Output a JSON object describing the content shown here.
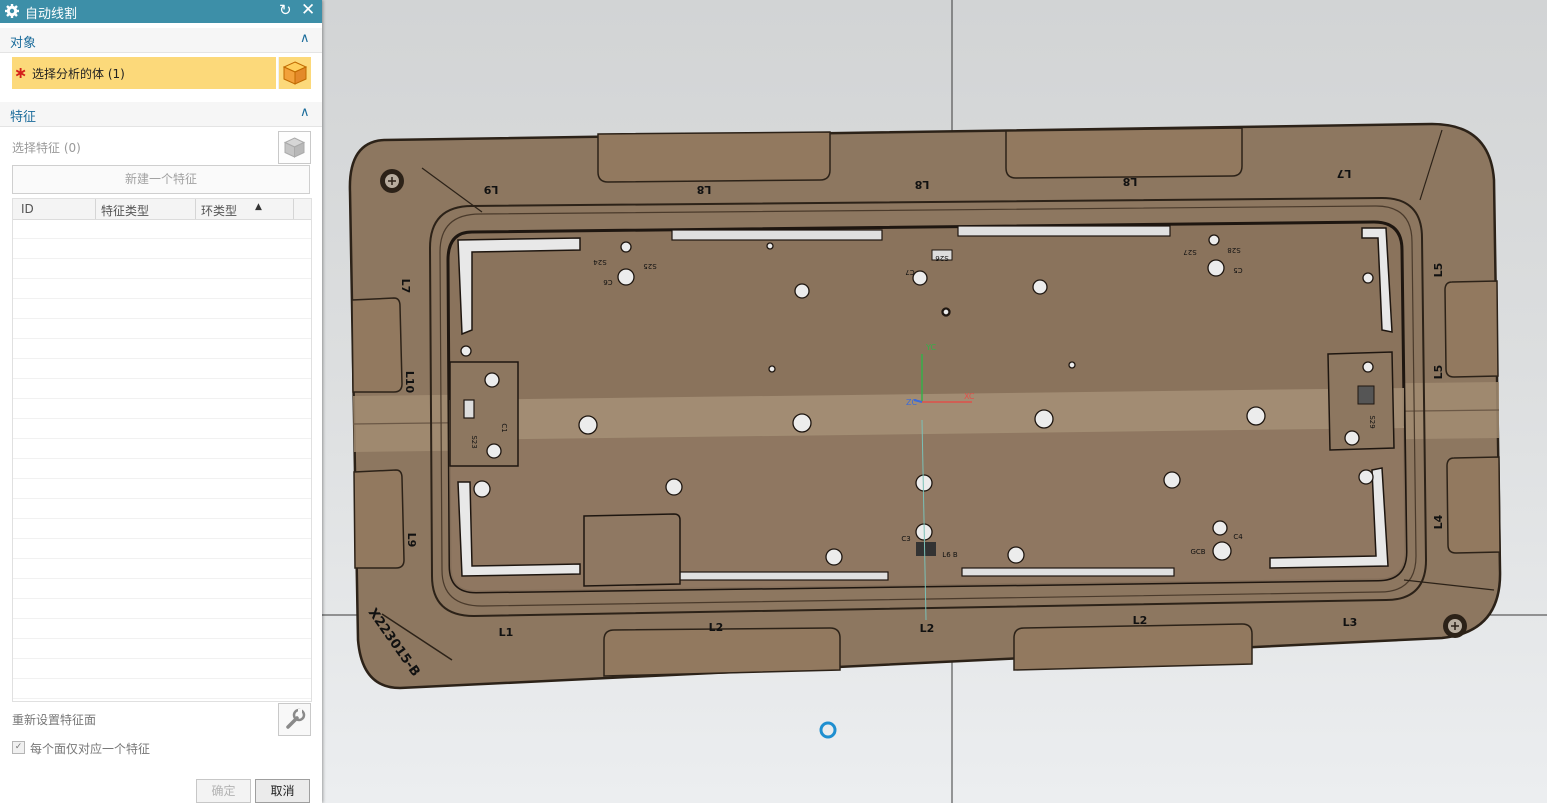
{
  "dialog": {
    "title": "自动线割",
    "groups": {
      "object": {
        "header": "对象",
        "select_body_label": "选择分析的体 (1)"
      },
      "feature": {
        "header": "特征",
        "select_feature_label": "选择特征 (0)",
        "new_feature_button": "新建一个特征",
        "table_columns": [
          "ID",
          "特征类型",
          "环类型"
        ],
        "reset_faces_label": "重新设置特征面",
        "one_feature_per_face_label": "每个面仅对应一个特征",
        "one_feature_per_face_checked": true
      }
    },
    "ok_button": "确定",
    "cancel_button": "取消"
  },
  "viewport": {
    "part_name": "X223015-B",
    "edge_labels": [
      "L1",
      "L2",
      "L2",
      "L2",
      "L3",
      "L4",
      "L5",
      "L5",
      "L7",
      "L8",
      "L8",
      "L8",
      "L9",
      "L9",
      "L10",
      "L7"
    ],
    "component_labels": [
      "S24",
      "S25",
      "C6",
      "S26",
      "C7",
      "S27",
      "S28",
      "C5",
      "C1",
      "S23",
      "S29",
      "C3",
      "L6 B",
      "C4",
      "GCB"
    ],
    "axis_labels": {
      "x": "XC",
      "y": "YC",
      "z": "ZC"
    }
  }
}
